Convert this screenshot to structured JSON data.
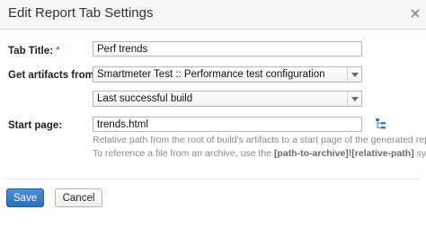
{
  "dialog": {
    "title": "Edit Report Tab Settings"
  },
  "form": {
    "tab_title": {
      "label": "Tab Title:",
      "required_mark": "*",
      "value": "Perf trends"
    },
    "artifacts": {
      "label": "Get artifacts from:",
      "required_mark": "*",
      "selected": "Smartmeter Test :: Performance test configuration"
    },
    "build": {
      "selected": "Last successful build"
    },
    "start_page": {
      "label": "Start page:",
      "value": "trends.html",
      "hint1": "Relative path from the root of build's artifacts to a start page of the generated report.",
      "hint2_prefix": "To reference a file from an archive, use the ",
      "hint2_code": "[path-to-archive]![relative-path]",
      "hint2_suffix": " syntax."
    }
  },
  "buttons": {
    "save": "Save",
    "cancel": "Cancel"
  },
  "colors": {
    "accent": "#3a7bc8",
    "required": "#d42e2e"
  },
  "icons": {
    "close": "close-icon",
    "dropdown": "chevron-down-icon",
    "tree": "tree-picker-icon"
  }
}
